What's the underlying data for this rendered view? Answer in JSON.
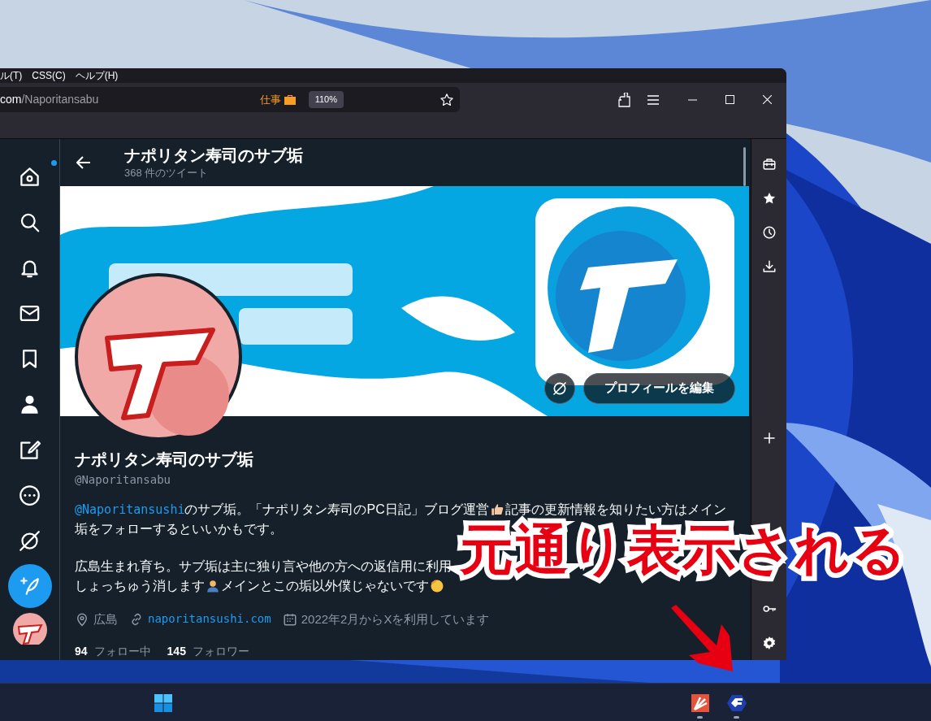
{
  "window": {
    "menu": [
      "ル(T)",
      "CSS(C)",
      "ヘルプ(H)"
    ],
    "url": {
      "host_tail": "com",
      "path": "/Naporitansabu"
    },
    "container_label": "仕事",
    "zoom": "110%"
  },
  "nav": [
    {
      "kind": "home",
      "dot": true
    },
    {
      "kind": "search",
      "dot": false
    },
    {
      "kind": "bell",
      "dot": false
    },
    {
      "kind": "mail",
      "dot": false
    },
    {
      "kind": "bookmark",
      "dot": false
    },
    {
      "kind": "person",
      "dot": false
    },
    {
      "kind": "edit",
      "dot": false
    },
    {
      "kind": "more",
      "dot": false
    },
    {
      "kind": "slash",
      "dot": false
    },
    {
      "kind": "compose",
      "dot": false
    },
    {
      "kind": "avatar",
      "dot": false
    }
  ],
  "header": {
    "title": "ナポリタン寿司のサブ垢",
    "tweet_count": "368 件のツイート"
  },
  "edit_profile_button": "プロフィールを編集",
  "profile": {
    "name": "ナポリタン寿司のサブ垢",
    "handle": "@Naporitansabu",
    "bio": [
      [
        [
          {
            "kind": "mention",
            "text": "@Naporitansushi"
          },
          {
            "kind": "text",
            "text": "のサブ垢。「ナポリタン寿司のPC日記」ブログ運営"
          },
          {
            "kind": "emoji"
          },
          {
            "kind": "text",
            "text": "記事の更新情報を知りたい方はメイン"
          }
        ],
        [
          {
            "kind": "text",
            "text": "垢をフォローするといいかもです。"
          }
        ]
      ],
      [
        [
          {
            "kind": "text",
            "text": "広島生まれ育ち。サブ垢は主に独り言や他の方への返信用に利用"
          }
        ],
        [
          {
            "kind": "text",
            "text": "しょっちゅう消します"
          },
          {
            "kind": "emoji"
          },
          {
            "kind": "text",
            "text": "メインとこの垢以外僕じゃないです"
          },
          {
            "kind": "emoji"
          }
        ]
      ]
    ],
    "meta": [
      {
        "kind": "location",
        "text": "広島"
      },
      {
        "kind": "link",
        "text": "naporitansushi.com"
      },
      {
        "kind": "joined",
        "text": "2022年2月からXを利用しています"
      }
    ],
    "stats": [
      {
        "count": "94",
        "label": "フォロー中"
      },
      {
        "count": "145",
        "label": "フォロワー"
      }
    ]
  },
  "sidebar": [
    {
      "kind": "briefcase"
    },
    {
      "kind": "star"
    },
    {
      "kind": "clock"
    },
    {
      "kind": "download"
    },
    {
      "kind": "gap"
    },
    {
      "kind": "plus"
    },
    {
      "kind": "gap"
    },
    {
      "kind": "key"
    },
    {
      "kind": "gear"
    }
  ],
  "annotation": "元通り表示される",
  "taskbar": [
    {
      "kind": "start",
      "running": false
    },
    {
      "kind": "app-red",
      "running": true
    },
    {
      "kind": "app-hex",
      "running": true
    }
  ]
}
